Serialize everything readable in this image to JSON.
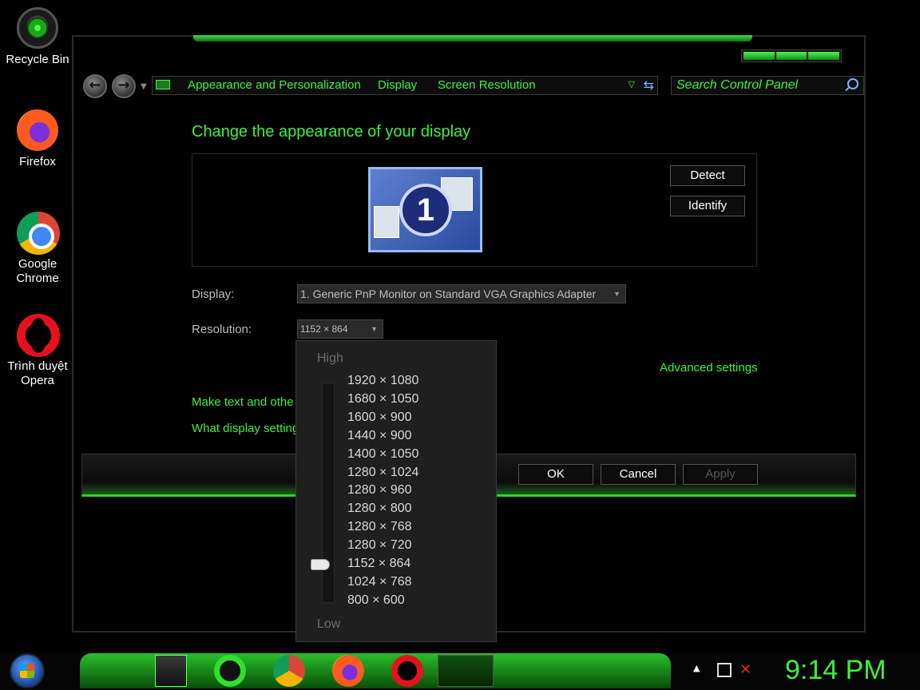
{
  "desktop": {
    "icons": [
      {
        "label": "Recycle Bin"
      },
      {
        "label": "Firefox"
      },
      {
        "label": "Google\nChrome"
      },
      {
        "label": "Trình duyệt\nOpera"
      }
    ]
  },
  "window": {
    "breadcrumbs": [
      "Appearance and Personalization",
      "Display",
      "Screen Resolution"
    ],
    "search_placeholder": "Search Control Panel",
    "heading": "Change the appearance of your display",
    "monitor_number": "1",
    "detect_label": "Detect",
    "identify_label": "Identify",
    "display_label": "Display:",
    "display_value": "1. Generic PnP Monitor on Standard VGA Graphics Adapter",
    "resolution_label": "Resolution:",
    "resolution_value": "1152 × 864",
    "advanced_link": "Advanced settings",
    "text_size_link": "Make text and othe",
    "help_link": "What display setting",
    "ok_label": "OK",
    "cancel_label": "Cancel",
    "apply_label": "Apply"
  },
  "resolution_dropdown": {
    "high_label": "High",
    "low_label": "Low",
    "options": [
      "1920 × 1080",
      "1680 × 1050",
      "1600 × 900",
      "1440 × 900",
      "1400 × 1050",
      "1280 × 1024",
      "1280 × 960",
      "1280 × 800",
      "1280 × 768",
      "1280 × 720",
      "1152 × 864",
      "1024 × 768",
      "800 × 600"
    ],
    "selected_index": 10
  },
  "taskbar": {
    "clock": "9:14 PM"
  },
  "colors": {
    "accent_green": "#3df03d",
    "background": "#000000"
  }
}
